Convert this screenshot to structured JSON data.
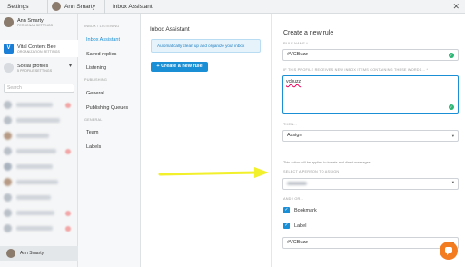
{
  "topbar": {
    "settings": "Settings",
    "user_name": "Ann Smarty",
    "page": "Inbox Assistant",
    "close_glyph": "✕"
  },
  "accounts": {
    "personal": {
      "name": "Ann Smarty",
      "sub": "PERSONAL SETTINGS"
    },
    "org": {
      "initial": "V",
      "name": "Vital Content Bee",
      "sub": "ORGANIZATION SETTINGS"
    },
    "social": {
      "name": "Social profiles",
      "sub": "5 PROFILE SETTINGS"
    },
    "search_placeholder": "Search",
    "bottom_user": "Ann Smarty"
  },
  "subnav": {
    "section_inbox": "INBOX / LISTENING",
    "inbox_assistant": "Inbox Assistant",
    "saved_replies": "Saved replies",
    "listening": "Listening",
    "section_publishing": "PUBLISHING",
    "general_pub": "General",
    "publishing_queues": "Publishing Queues",
    "section_general": "GENERAL",
    "team": "Team",
    "labels": "Labels"
  },
  "middle": {
    "title": "Inbox Assistant",
    "info": "Automatically clean up and organize your inbox",
    "create_button": "+ Create a new rule"
  },
  "rule": {
    "title": "Create a new rule",
    "name_label": "RULE NAME *",
    "name_value": "#VCBuzz",
    "words_label": "IF THIS PROFILE RECEIVES NEW INBOX ITEMS CONTAINING THESE WORDS... *",
    "words_value": "vcbuzz",
    "then_label": "THEN...",
    "action_value": "Assign",
    "action_note": "This action will be applied to tweets and direct messages",
    "person_label": "SELECT A PERSON TO ASSIGN",
    "and_label": "AND / OR...",
    "bookmark_label": "Bookmark",
    "label_label": "Label",
    "label_value": "#VCBuzz"
  },
  "colors": {
    "accent": "#1a8fd6",
    "success": "#2bb673",
    "arrow": "#f2ef2b",
    "chat": "#f47c20"
  },
  "icons": {
    "close": "close-icon",
    "chevron": "chevron-down-icon",
    "check": "check-icon",
    "chat": "chat-icon"
  }
}
